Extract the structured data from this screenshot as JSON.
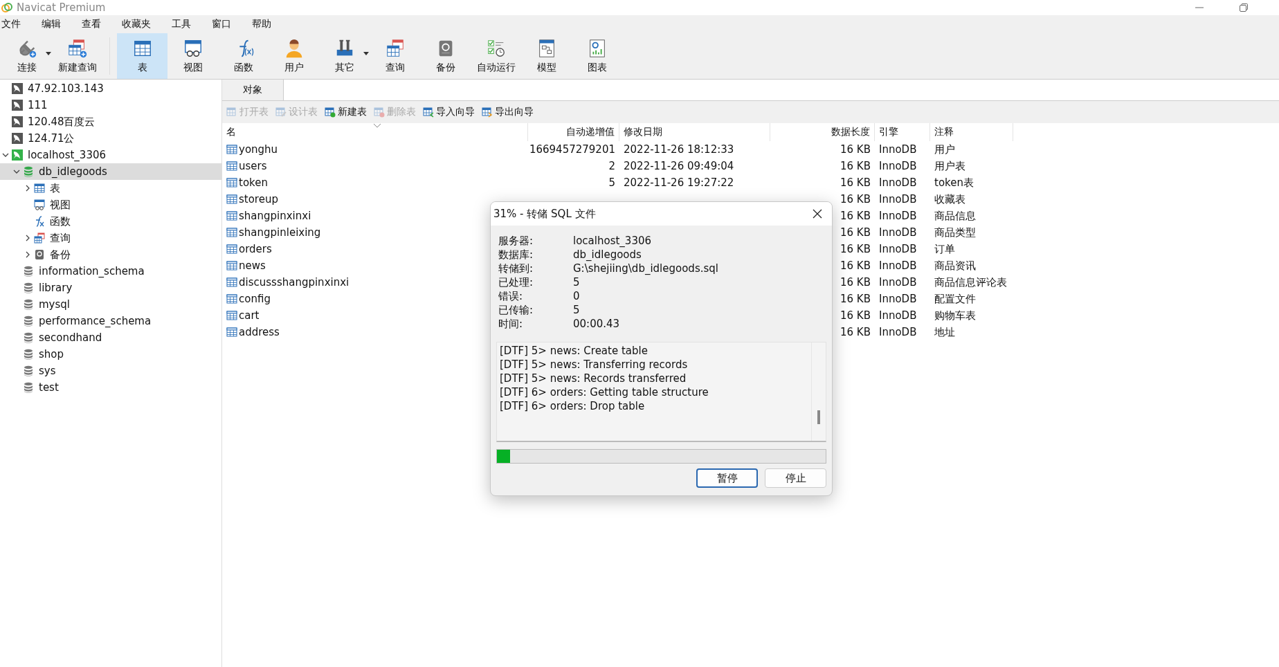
{
  "window": {
    "title": "Navicat Premium"
  },
  "menu": [
    "文件",
    "编辑",
    "查看",
    "收藏夹",
    "工具",
    "窗口",
    "帮助"
  ],
  "toolbar": {
    "groups": [
      [
        {
          "label": "连接",
          "kind": "connect",
          "dropdown": true,
          "selected": false
        },
        {
          "label": "新建查询",
          "kind": "new-query",
          "dropdown": false,
          "selected": false
        }
      ],
      [
        {
          "label": "表",
          "kind": "table",
          "dropdown": false,
          "selected": true
        },
        {
          "label": "视图",
          "kind": "view",
          "dropdown": false,
          "selected": false
        },
        {
          "label": "函数",
          "kind": "function",
          "dropdown": false,
          "selected": false
        },
        {
          "label": "用户",
          "kind": "user",
          "dropdown": false,
          "selected": false
        },
        {
          "label": "其它",
          "kind": "other",
          "dropdown": true,
          "selected": false
        },
        {
          "label": "查询",
          "kind": "query",
          "dropdown": false,
          "selected": false
        },
        {
          "label": "备份",
          "kind": "backup",
          "dropdown": false,
          "selected": false
        },
        {
          "label": "自动运行",
          "kind": "automation",
          "dropdown": false,
          "selected": false
        },
        {
          "label": "模型",
          "kind": "model",
          "dropdown": false,
          "selected": false
        },
        {
          "label": "图表",
          "kind": "chart",
          "dropdown": false,
          "selected": false
        }
      ]
    ]
  },
  "sidebar": {
    "items": [
      {
        "label": "47.92.103.143",
        "kind": "connection",
        "active": false,
        "selected": false
      },
      {
        "label": "111",
        "kind": "connection",
        "active": false,
        "selected": false
      },
      {
        "label": "120.48百度云",
        "kind": "connection",
        "active": false,
        "selected": false
      },
      {
        "label": "124.71公",
        "kind": "connection",
        "active": false,
        "selected": false
      },
      {
        "label": "localhost_3306",
        "kind": "connection",
        "active": true,
        "selected": false,
        "expanded": true,
        "children": [
          {
            "label": "db_idlegoods",
            "kind": "database",
            "active": true,
            "selected": true,
            "expanded": true,
            "children": [
              {
                "label": "表",
                "kind": "tables",
                "selected": false,
                "expanded": false
              },
              {
                "label": "视图",
                "kind": "views",
                "selected": false
              },
              {
                "label": "函数",
                "kind": "functions",
                "selected": false
              },
              {
                "label": "查询",
                "kind": "queries",
                "selected": false,
                "expanded": false
              },
              {
                "label": "备份",
                "kind": "backups",
                "selected": false,
                "expanded": false
              }
            ]
          },
          {
            "label": "information_schema",
            "kind": "database",
            "active": false,
            "selected": false
          },
          {
            "label": "library",
            "kind": "database",
            "active": false,
            "selected": false
          },
          {
            "label": "mysql",
            "kind": "database",
            "active": false,
            "selected": false
          },
          {
            "label": "performance_schema",
            "kind": "database",
            "active": false,
            "selected": false
          },
          {
            "label": "secondhand",
            "kind": "database",
            "active": false,
            "selected": false
          },
          {
            "label": "shop",
            "kind": "database",
            "active": false,
            "selected": false
          },
          {
            "label": "sys",
            "kind": "database",
            "active": false,
            "selected": false
          },
          {
            "label": "test",
            "kind": "database",
            "active": false,
            "selected": false
          }
        ]
      }
    ]
  },
  "tabs": [
    {
      "label": "对象",
      "selected": true
    }
  ],
  "object_toolbar": [
    {
      "label": "打开表",
      "kind": "open",
      "disabled": true
    },
    {
      "label": "设计表",
      "kind": "design",
      "disabled": true
    },
    {
      "label": "新建表",
      "kind": "new",
      "disabled": false
    },
    {
      "label": "删除表",
      "kind": "delete",
      "disabled": true
    },
    {
      "label": "导入向导",
      "kind": "import",
      "disabled": false
    },
    {
      "label": "导出向导",
      "kind": "export",
      "disabled": false
    }
  ],
  "table": {
    "columns": [
      "名",
      "自动递增值",
      "修改日期",
      "数据长度",
      "引擎",
      "注释"
    ],
    "rows": [
      {
        "name": "yonghu",
        "auto_increment": "1669457279201",
        "modified": "2022-11-26 18:12:33",
        "data_length": "16 KB",
        "engine": "InnoDB",
        "comment": "用户"
      },
      {
        "name": "users",
        "auto_increment": "2",
        "modified": "2022-11-26 09:49:04",
        "data_length": "16 KB",
        "engine": "InnoDB",
        "comment": "用户表"
      },
      {
        "name": "token",
        "auto_increment": "5",
        "modified": "2022-11-26 19:27:22",
        "data_length": "16 KB",
        "engine": "InnoDB",
        "comment": "token表"
      },
      {
        "name": "storeup",
        "data_length": "16 KB",
        "engine": "InnoDB",
        "comment": "收藏表"
      },
      {
        "name": "shangpinxinxi",
        "data_length": "16 KB",
        "engine": "InnoDB",
        "comment": "商品信息"
      },
      {
        "name": "shangpinleixing",
        "data_length": "16 KB",
        "engine": "InnoDB",
        "comment": "商品类型"
      },
      {
        "name": "orders",
        "data_length": "16 KB",
        "engine": "InnoDB",
        "comment": "订单"
      },
      {
        "name": "news",
        "data_length": "16 KB",
        "engine": "InnoDB",
        "comment": "商品资讯"
      },
      {
        "name": "discussshangpinxinxi",
        "data_length": "16 KB",
        "engine": "InnoDB",
        "comment": "商品信息评论表"
      },
      {
        "name": "config",
        "data_length": "16 KB",
        "engine": "InnoDB",
        "comment": "配置文件"
      },
      {
        "name": "cart",
        "data_length": "16 KB",
        "engine": "InnoDB",
        "comment": "购物车表"
      },
      {
        "name": "address",
        "data_length": "16 KB",
        "engine": "InnoDB",
        "comment": "地址"
      }
    ]
  },
  "dialog": {
    "title": "31% - 转储 SQL 文件",
    "fields": [
      {
        "label": "服务器:",
        "value": "localhost_3306"
      },
      {
        "label": "数据库:",
        "value": "db_idlegoods"
      },
      {
        "label": "转储到:",
        "value": "G:\\shejiing\\db_idlegoods.sql"
      },
      {
        "label": "已处理:",
        "value": "5"
      },
      {
        "label": "错误:",
        "value": "0"
      },
      {
        "label": "已传输:",
        "value": "5"
      },
      {
        "label": "时间:",
        "value": "00:00.43"
      }
    ],
    "log": [
      "[DTF] 5> news: Create table",
      "[DTF] 5> news: Transferring records",
      "[DTF] 5> news: Records transferred",
      "[DTF] 6> orders: Getting table structure",
      "[DTF] 6> orders: Drop table"
    ],
    "progress": {
      "level": 0.04
    },
    "buttons": [
      {
        "label": "暂停",
        "default": true
      },
      {
        "label": "停止",
        "default": false
      }
    ]
  }
}
